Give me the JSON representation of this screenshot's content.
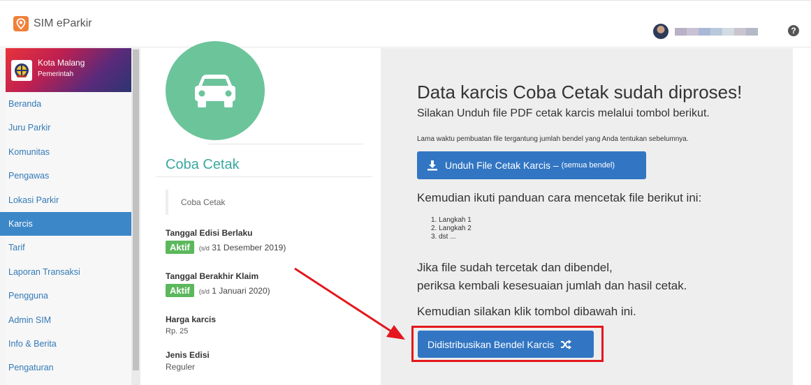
{
  "app": {
    "title": "SIM eParkir"
  },
  "header": {
    "help_icon": "question-circle-icon"
  },
  "sidebar": {
    "org_name": "Kota Malang",
    "org_sub": "Pemerintah",
    "items": [
      {
        "label": "Beranda"
      },
      {
        "label": "Juru Parkir"
      },
      {
        "label": "Komunitas"
      },
      {
        "label": "Pengawas"
      },
      {
        "label": "Lokasi Parkir"
      },
      {
        "label": "Karcis",
        "active": true
      },
      {
        "label": "Tarif"
      },
      {
        "label": "Laporan Transaksi"
      },
      {
        "label": "Pengguna"
      },
      {
        "label": "Admin SIM"
      },
      {
        "label": "Info & Berita"
      },
      {
        "label": "Pengaturan"
      }
    ]
  },
  "edisi": {
    "title": "Coba Cetak",
    "description": "Coba Cetak",
    "tanggal_edisi_label": "Tanggal Edisi Berlaku",
    "tanggal_edisi_badge": "Aktif",
    "tanggal_edisi_prefix": "(s/d",
    "tanggal_edisi_date": "31 Desember 2019)",
    "tanggal_klaim_label": "Tanggal Berakhir Klaim",
    "tanggal_klaim_badge": "Aktif",
    "tanggal_klaim_prefix": "(s/d",
    "tanggal_klaim_date": "1 Januari 2020)",
    "harga_label": "Harga karcis",
    "harga_value": "Rp. 25",
    "jenis_label": "Jenis Edisi",
    "jenis_value": "Reguler"
  },
  "main": {
    "heading": "Data karcis Coba Cetak sudah diproses!",
    "subheading": "Silakan Unduh file PDF cetak karcis melalui tombol berikut.",
    "note": "Lama waktu pembuatan file tergantung jumlah bendel yang Anda tentukan sebelumnya.",
    "download_button": "Unduh File Cetak Karcis –",
    "download_button_sub": "(semua bendel)",
    "guide_text": "Kemudian ikuti panduan cara mencetak file berikut ini:",
    "steps": [
      "1. Langkah 1",
      "2. Langkah 2",
      "3. dst ..."
    ],
    "check_text_1": "Jika file sudah tercetak dan dibendel,",
    "check_text_2": "periksa kembali kesesuaian jumlah dan hasil cetak.",
    "click_text": "Kemudian silakan klik tombol dibawah ini.",
    "distribute_button": "Didistribusikan Bendel Karcis"
  },
  "colors": {
    "sidebar_active": "#3c87c8",
    "button_primary": "#3276c3",
    "badge_success": "#5cb85c",
    "title_teal": "#3aa9a0",
    "car_circle": "#6cc49b",
    "annotation_red": "#e3171d"
  }
}
